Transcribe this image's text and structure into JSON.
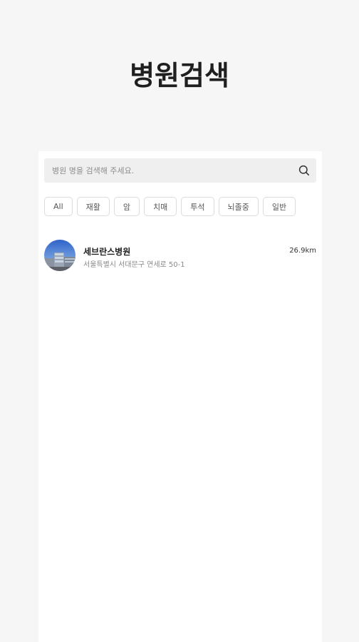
{
  "header": {
    "title": "병원검색"
  },
  "search": {
    "placeholder": "병원 명을 검색해 주세요.",
    "value": ""
  },
  "filters": [
    "All",
    "재활",
    "암",
    "치매",
    "투석",
    "뇌졸중",
    "일반"
  ],
  "hospitals": [
    {
      "name": "세브란스병원",
      "address": "서울특별시 서대문구 연세로 50-1",
      "distance": "26.9km"
    }
  ],
  "icons": {
    "search": "search-icon",
    "avatar": "hospital-building-photo"
  },
  "colors": {
    "background": "#f6f6f6",
    "panel": "#ffffff",
    "search_bg": "#efefef",
    "chip_border": "#dcdcdc",
    "title": "#1f1f1f"
  }
}
